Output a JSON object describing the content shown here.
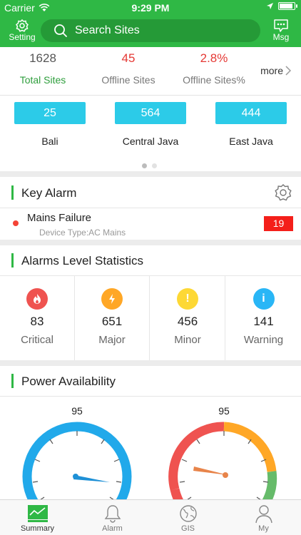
{
  "status_bar": {
    "carrier": "Carrier",
    "time": "9:29 PM"
  },
  "header": {
    "setting_label": "Setting",
    "search_placeholder": "Search Sites",
    "msg_label": "Msg"
  },
  "summary": {
    "total": {
      "value": "1628",
      "label": "Total Sites"
    },
    "offline": {
      "value": "45",
      "label": "Offline Sites"
    },
    "offline_pct": {
      "value": "2.8%",
      "label": "Offline Sites%"
    },
    "more_label": "more"
  },
  "regions": [
    {
      "count": "25",
      "name": "Bali"
    },
    {
      "count": "564",
      "name": "Central Java"
    },
    {
      "count": "444",
      "name": "East Java"
    }
  ],
  "key_alarm": {
    "title": "Key Alarm",
    "item": {
      "title": "Mains Failure",
      "subtitle": "Device Type:AC Mains",
      "count": "19"
    }
  },
  "alarm_levels": {
    "title": "Alarms Level Statistics",
    "items": [
      {
        "count": "83",
        "label": "Critical",
        "color": "#ef5350"
      },
      {
        "count": "651",
        "label": "Major",
        "color": "#ffa726"
      },
      {
        "count": "456",
        "label": "Minor",
        "color": "#fdd835"
      },
      {
        "count": "141",
        "label": "Warning",
        "color": "#29b6f6"
      }
    ]
  },
  "power": {
    "title": "Power Availability",
    "gauges": [
      {
        "value": "95"
      },
      {
        "value": "95"
      }
    ]
  },
  "tabs": [
    {
      "label": "Summary",
      "icon": "summary-chart-icon"
    },
    {
      "label": "Alarm",
      "icon": "bell-icon"
    },
    {
      "label": "GIS",
      "icon": "globe-icon"
    },
    {
      "label": "My",
      "icon": "user-icon"
    }
  ],
  "colors": {
    "brand": "#2fb845",
    "accent": "#2ccbe8",
    "danger": "#f41f1a"
  }
}
